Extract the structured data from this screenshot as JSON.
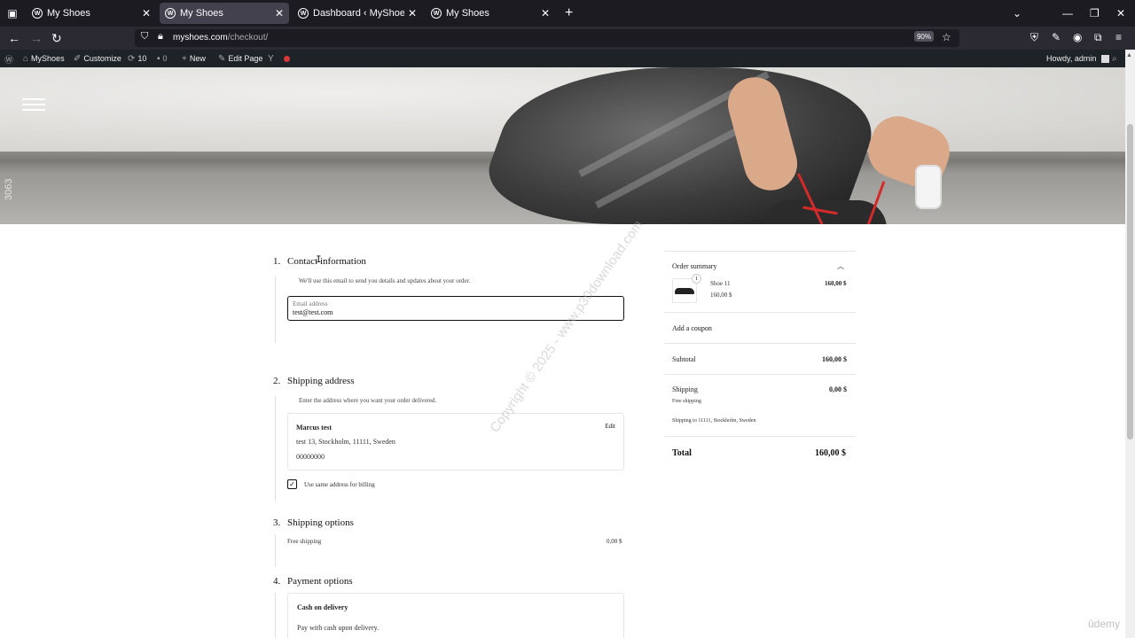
{
  "browser": {
    "tabs": [
      {
        "title": "My Shoes",
        "active": false
      },
      {
        "title": "My Shoes",
        "active": true
      },
      {
        "title": "Dashboard ‹ MyShoes — WordPress",
        "active": false
      },
      {
        "title": "My Shoes",
        "active": false
      }
    ],
    "url_host": "myshoes.com",
    "url_path": "/checkout/",
    "zoom": "90%"
  },
  "adminbar": {
    "site": "MyShoes",
    "customize": "Customize",
    "updates": "10",
    "comments": "0",
    "new": "New",
    "edit_page": "Edit Page",
    "howdy": "Howdy, admin"
  },
  "hero": {
    "side_code": "3063"
  },
  "checkout": {
    "contact": {
      "num": "1.",
      "title": "Contact information",
      "help": "We'll use this email to send you details and updates about your order.",
      "email_label": "Email address",
      "email_value": "test@test.com"
    },
    "shipping_address": {
      "num": "2.",
      "title": "Shipping address",
      "help": "Enter the address where you want your order delivered.",
      "name": "Marcus test",
      "address": "test 13, Stockholm, 11111, Sweden",
      "phone": "00000000",
      "edit": "Edit",
      "same_billing": "Use same address for billing"
    },
    "shipping_options": {
      "num": "3.",
      "title": "Shipping options",
      "option_label": "Free shipping",
      "option_price": "0,00 $"
    },
    "payment": {
      "num": "4.",
      "title": "Payment options",
      "method": "Cash on delivery",
      "desc": "Pay with cash upon delivery."
    }
  },
  "summary": {
    "title": "Order summary",
    "item": {
      "qty": "1",
      "name": "Shoe 11",
      "unit_price": "160,00 $",
      "total": "160,00 $"
    },
    "coupon": "Add a coupon",
    "subtotal_label": "Subtotal",
    "subtotal": "160,00 $",
    "shipping_label": "Shipping",
    "shipping": "0,00 $",
    "shipping_method": "Free shipping",
    "shipping_to": "Shipping to 11111, Stockholm, Sweden",
    "total_label": "Total",
    "total": "160,00 $"
  },
  "overlay": {
    "watermark": "Copyright © 2025 - www.p30download.com",
    "brand": "ûdemy"
  }
}
